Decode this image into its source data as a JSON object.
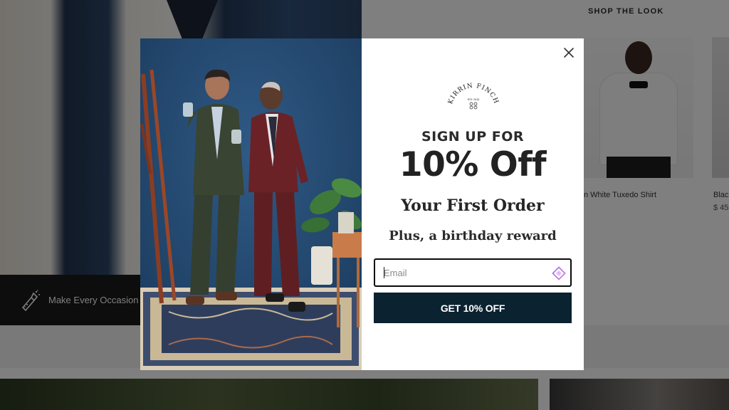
{
  "background_page": {
    "section_title": "SHOP THE LOOK",
    "banner_text": "Make Every Occasion",
    "product_1_name": "n White Tuxedo Shirt",
    "product_2_name": "Blac",
    "product_2_price": "$ 45"
  },
  "popup": {
    "logo": {
      "brand": "KIRRIN FINCH",
      "established": "EST. 2015"
    },
    "headline_1": "SIGN UP FOR",
    "headline_2": "10% Off",
    "headline_3": "Your First Order",
    "headline_4": "Plus, a birthday reward",
    "email_placeholder": "Email",
    "email_value": "",
    "submit_label": "GET 10% OFF",
    "close_icon": "close-icon",
    "autofill_icon": "password-manager-icon"
  },
  "colors": {
    "overlay": "rgba(0,0,0,0.5)",
    "button_bg": "#0b2230",
    "button_text": "#ffffff",
    "modal_bg": "#ffffff",
    "photo_backdrop": "#24486e"
  }
}
